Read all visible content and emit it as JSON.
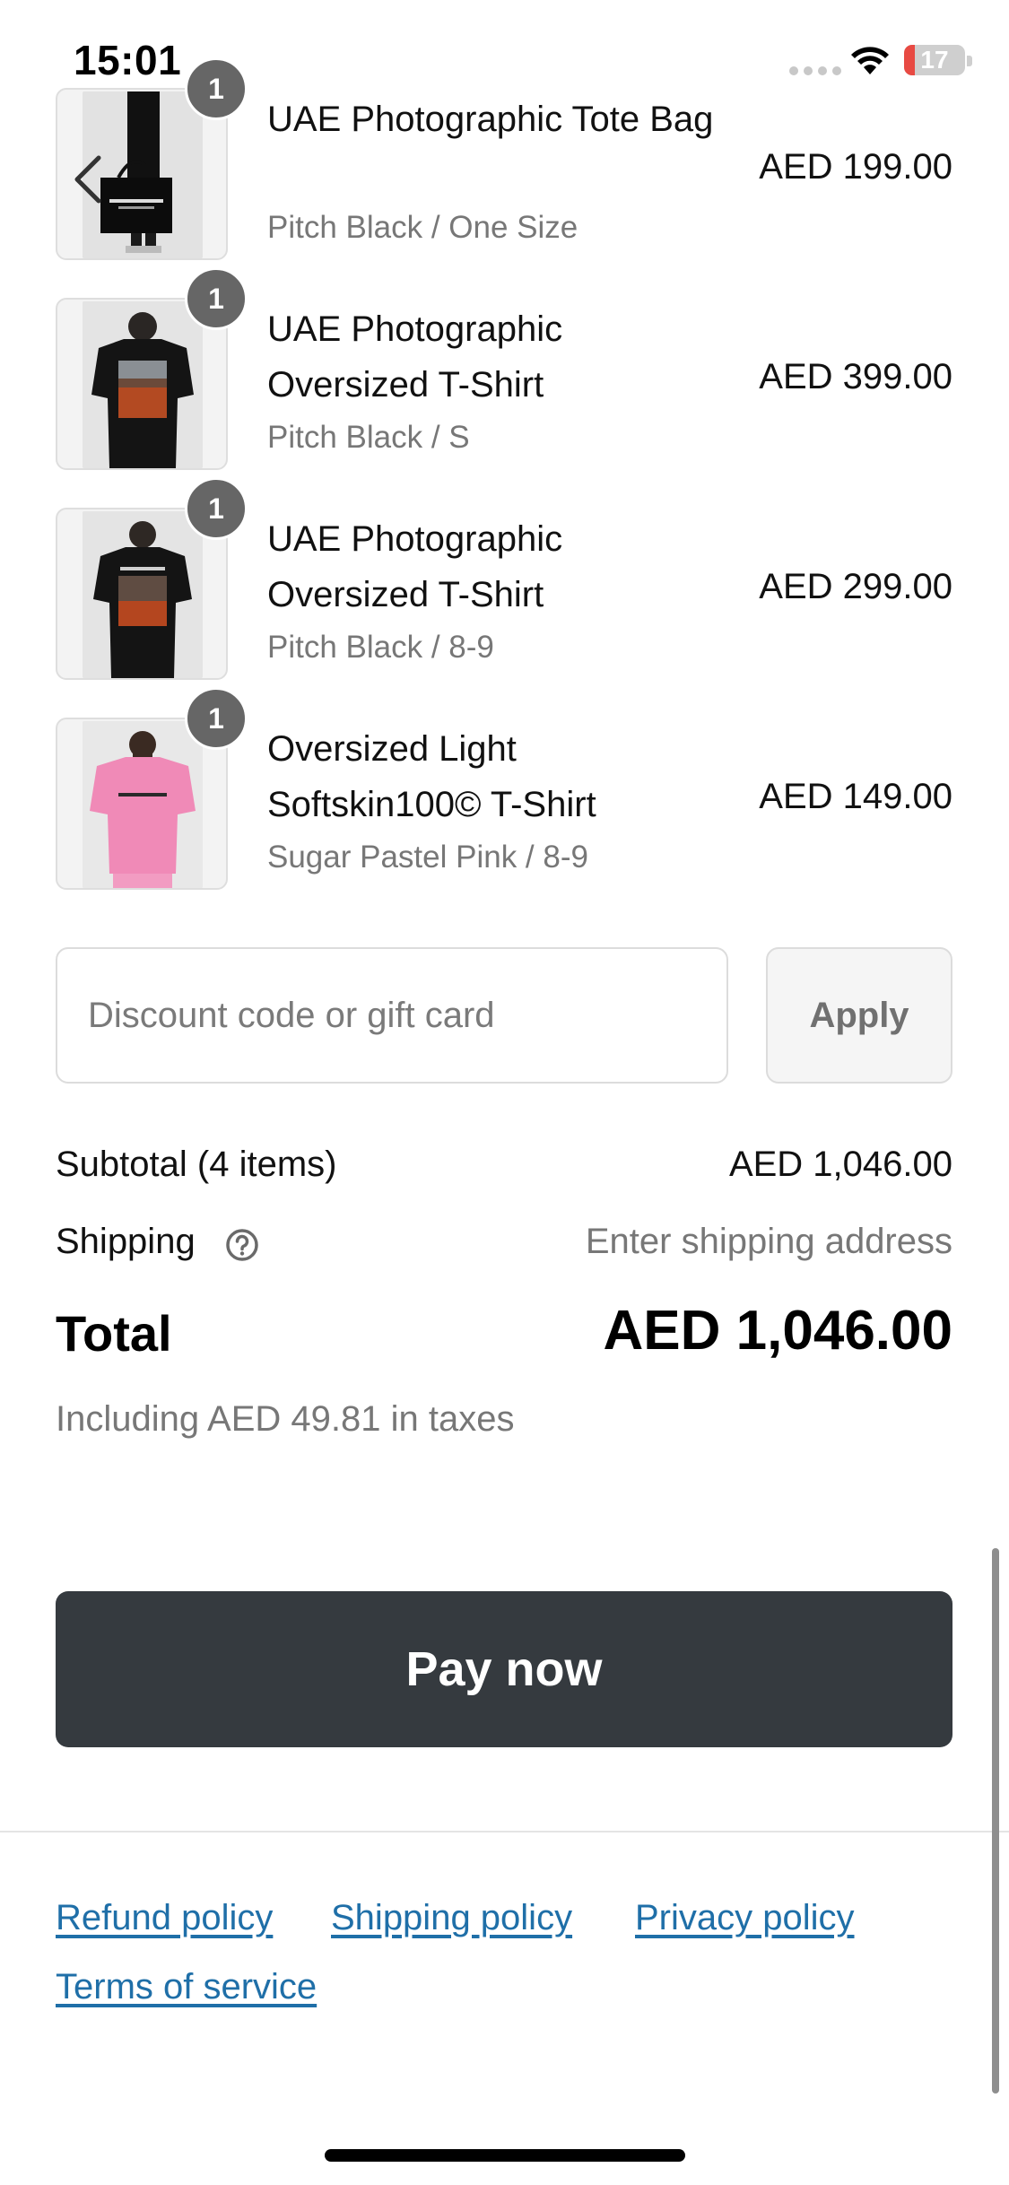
{
  "status_bar": {
    "time": "15:01",
    "battery": "17",
    "battery_level": 0.17,
    "icons": [
      "cellular-signal-icon",
      "wifi-icon",
      "battery-icon"
    ]
  },
  "items": [
    {
      "title": "UAE Photographic Tote Bag",
      "variant": "Pitch Black / One Size",
      "price": "AED 199.00",
      "quantity": "1"
    },
    {
      "title": "UAE Photographic Oversized T-Shirt",
      "variant": "Pitch Black / S",
      "price": "AED 399.00",
      "quantity": "1"
    },
    {
      "title": "UAE Photographic Oversized T-Shirt",
      "variant": "Pitch Black / 8-9",
      "price": "AED 299.00",
      "quantity": "1"
    },
    {
      "title": "Oversized Light Softskin100© T-Shirt",
      "variant": "Sugar Pastel Pink / 8-9",
      "price": "AED 149.00",
      "quantity": "1"
    }
  ],
  "discount": {
    "placeholder": "Discount code or gift card",
    "value": "",
    "apply_label": "Apply"
  },
  "summary": {
    "subtotal_label": "Subtotal (4 items)",
    "subtotal_value": "AED 1,046.00",
    "shipping_label": "Shipping",
    "shipping_value": "Enter shipping address",
    "total_label": "Total",
    "total_value": "AED 1,046.00",
    "taxes_note": "Including AED 49.81 in taxes"
  },
  "pay_button": "Pay now",
  "footer": {
    "refund_policy": "Refund policy",
    "shipping_policy": "Shipping policy",
    "privacy_policy": "Privacy policy",
    "terms_of_service": "Terms of service"
  },
  "colors": {
    "pay_button": "#353a3f",
    "link": "#1f6fa8",
    "muted_text": "#777777",
    "badge": "#666666",
    "battery_low": "#e84a43"
  }
}
